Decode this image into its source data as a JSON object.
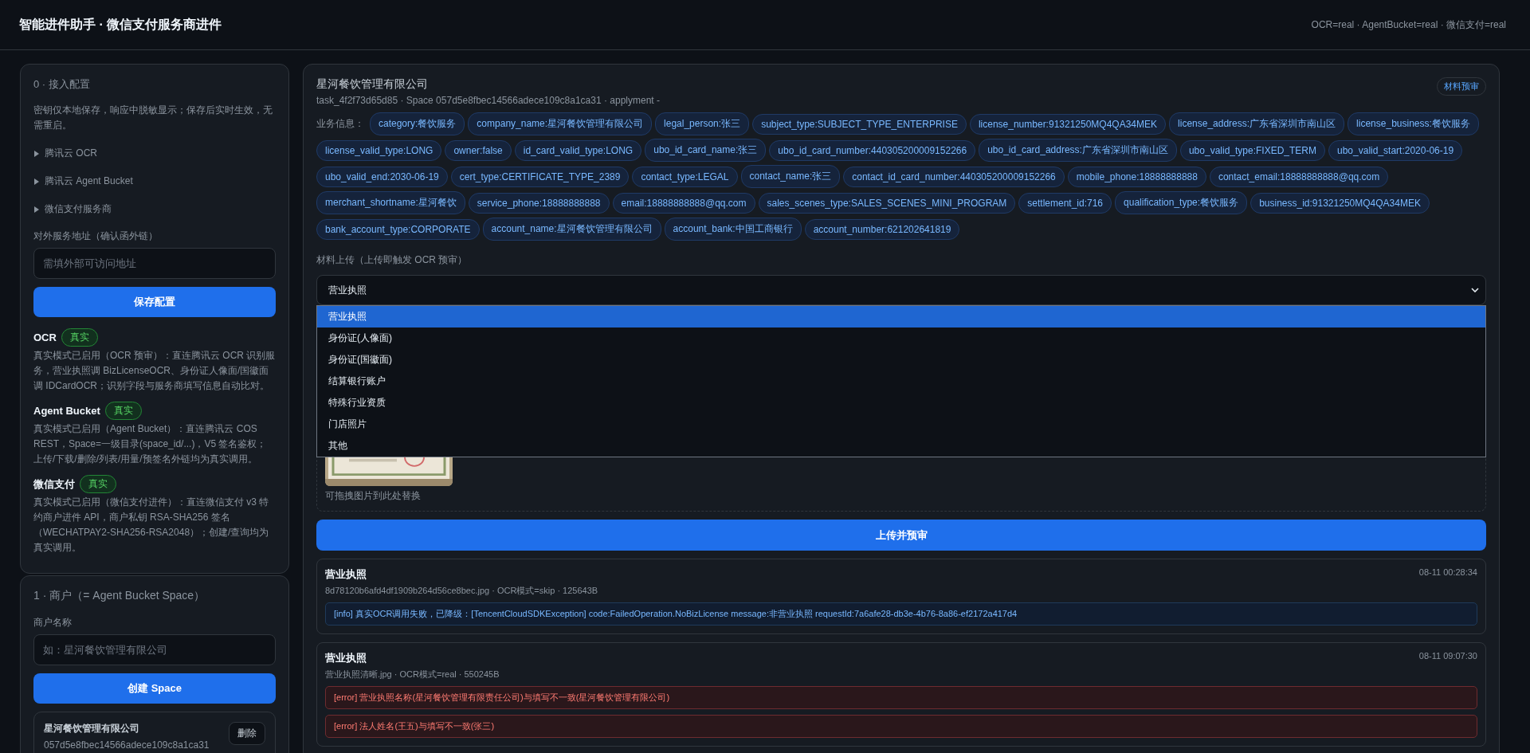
{
  "header": {
    "title": "智能进件助手 · 微信支付服务商进件",
    "status": "OCR=real · AgentBucket=real · 微信支付=real"
  },
  "config": {
    "heading": "0 · 接入配置",
    "note": "密钥仅本地保存，响应中脱敏显示；保存后实时生效，无需重启。",
    "sections": [
      {
        "label": "腾讯云 OCR",
        "expanded": false
      },
      {
        "label": "腾讯云 Agent Bucket",
        "expanded": false
      },
      {
        "label": "微信支付服务商",
        "expanded": false
      }
    ],
    "url_label": "对外服务地址（确认函外链）",
    "url_placeholder": "需填外部可访问地址",
    "save_button": "保存配置",
    "modes": [
      {
        "name": "OCR",
        "badge": "真实",
        "description": "真实模式已启用（OCR 预审）：直连腾讯云 OCR 识别服务，营业执照调 BizLicenseOCR、身份证人像面/国徽面调 IDCardOCR；识别字段与服务商填写信息自动比对。"
      },
      {
        "name": "Agent Bucket",
        "badge": "真实",
        "description": "真实模式已启用（Agent Bucket）：直连腾讯云 COS REST，Space=一级目录(space_id/...)，V5 签名鉴权；上传/下载/删除/列表/用量/预签名外链均为真实调用。"
      },
      {
        "name": "微信支付",
        "badge": "真实",
        "description": "真实模式已启用（微信支付进件）：直连微信支付 v3 特约商户进件 API，商户私钥 RSA-SHA256 签名（WECHATPAY2-SHA256-RSA2048）；创建/查询均为真实调用。"
      }
    ]
  },
  "merchant": {
    "heading": "1 · 商户（= Agent Bucket Space）",
    "name_label": "商户名称",
    "name_placeholder": "如：星河餐饮管理有限公司",
    "create_button": "创建 Space",
    "spaces": [
      {
        "name": "星河餐饮管理有限公司",
        "id": "057d5e8fbec14566adece109c8a1ca31",
        "delete_button": "删除"
      }
    ]
  },
  "task": {
    "company": "星河餐饮管理有限公司",
    "meta": "task_4f2f73d65d85 · Space 057d5e8fbec14566adece109c8a1ca31 · applyment -",
    "badge": "材料预审",
    "info_label": "业务信息：",
    "tags": [
      "category:餐饮服务",
      "company_name:星河餐饮管理有限公司",
      "legal_person:张三",
      "subject_type:SUBJECT_TYPE_ENTERPRISE",
      "license_number:91321250MQ4QA34MEK",
      "license_address:广东省深圳市南山区",
      "license_business:餐饮服务",
      "license_valid_type:LONG",
      "owner:false",
      "id_card_valid_type:LONG",
      "ubo_id_card_name:张三",
      "ubo_id_card_number:440305200009152266",
      "ubo_id_card_address:广东省深圳市南山区",
      "ubo_valid_type:FIXED_TERM",
      "ubo_valid_start:2020-06-19",
      "ubo_valid_end:2030-06-19",
      "cert_type:CERTIFICATE_TYPE_2389",
      "contact_type:LEGAL",
      "contact_name:张三",
      "contact_id_card_number:440305200009152266",
      "mobile_phone:18888888888",
      "contact_email:18888888888@qq.com",
      "merchant_shortname:星河餐饮",
      "service_phone:18888888888",
      "email:18888888888@qq.com",
      "sales_scenes_type:SALES_SCENES_MINI_PROGRAM",
      "settlement_id:716",
      "qualification_type:餐饮服务",
      "business_id:91321250MQ4QA34MEK",
      "bank_account_type:CORPORATE",
      "account_name:星河餐饮管理有限公司",
      "account_bank:中国工商银行",
      "account_number:621202641819"
    ],
    "upload_label": "材料上传（上传即触发 OCR 预审）",
    "select": {
      "value": "营业执照",
      "expanded": true,
      "options": [
        {
          "label": "营业执照",
          "selected": true
        },
        {
          "label": "身份证(人像面)",
          "selected": false
        },
        {
          "label": "身份证(国徽面)",
          "selected": false
        },
        {
          "label": "结算银行账户",
          "selected": false
        },
        {
          "label": "特殊行业资质",
          "selected": false
        },
        {
          "label": "门店照片",
          "selected": false
        },
        {
          "label": "其他",
          "selected": false
        }
      ]
    },
    "upload_hint": "可拖拽图片到此处替换",
    "upload_button": "上传并预审",
    "logs": [
      {
        "title": "营业执照",
        "meta": "8d78120b6afd4df1909b264d56ce8bec.jpg · OCR模式=skip · 125643B",
        "time": "08-11 00:28:34",
        "messages": [
          {
            "kind": "info",
            "text": "[info] 真实OCR调用失败，已降级：[TencentCloudSDKException] code:FailedOperation.NoBizLicense message:非营业执照 requestId:7a6afe28-db3e-4b76-8a86-ef2172a417d4"
          }
        ]
      },
      {
        "title": "营业执照",
        "meta": "营业执照清晰.jpg · OCR模式=real · 550245B",
        "time": "08-11 09:07:30",
        "messages": [
          {
            "kind": "error",
            "text": "[error] 营业执照名称(星河餐饮管理有限责任公司)与填写不一致(星河餐饮管理有限公司)"
          },
          {
            "kind": "error",
            "text": "[error] 法人姓名(王五)与填写不一致(张三)"
          }
        ]
      }
    ]
  }
}
